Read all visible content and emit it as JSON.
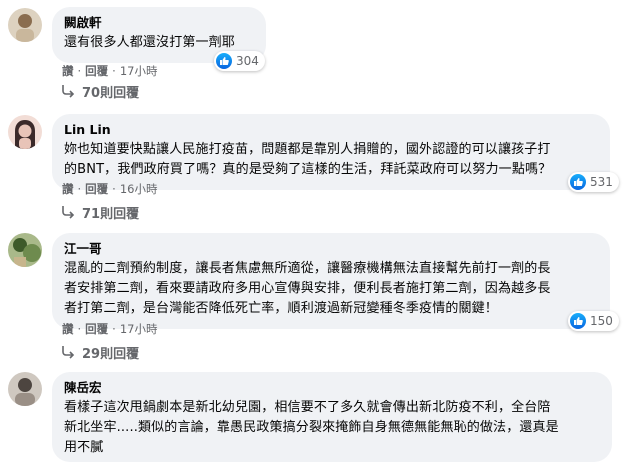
{
  "comments": [
    {
      "author": "闕啟軒",
      "lines": [
        "還有很多人都還沒打第一劑耶"
      ],
      "reaction_count": "304",
      "actions": {
        "like": "讚",
        "reply": "回覆",
        "time": "17小時"
      },
      "replies_label": "70則回覆",
      "avatar_colors": [
        "#c9b79c",
        "#8a6d4f"
      ]
    },
    {
      "author": "Lin Lin",
      "lines": [
        "妳也知道要快點讓人民施打疫苗，問題都是靠別人捐贈的，國外認證的可以讓孩子打",
        "的BNT，我們政府買了嗎？真的是受夠了這樣的生活，拜託菜政府可以努力一點嗎？"
      ],
      "reaction_count": "531",
      "actions": {
        "like": "讚",
        "reply": "回覆",
        "time": "16小時"
      },
      "replies_label": "71則回覆",
      "avatar_colors": [
        "#e8c4b8",
        "#3b2a2a"
      ]
    },
    {
      "author": "江一哥",
      "lines": [
        "混亂的二劑預約制度，讓長者焦慮無所適從，讓醫療機構無法直接幫先前打一劑的長",
        "者安排第二劑，看來要請政府多用心宣傳與安排，便利長者施打第二劑，因為越多長",
        "者打第二劑，是台灣能否降低死亡率，順利渡過新冠變種冬季疫情的關鍵！"
      ],
      "reaction_count": "150",
      "actions": {
        "like": "讚",
        "reply": "回覆",
        "time": "17小時"
      },
      "replies_label": "29則回覆",
      "avatar_colors": [
        "#6e8b4e",
        "#3d5a2a"
      ]
    },
    {
      "author": "陳岳宏",
      "lines": [
        "看樣子這次甩鍋劇本是新北幼兒園，相信要不了多久就會傳出新北防疫不利，全台陪",
        "新北坐牢.....類似的言論，靠愚民政策搞分裂來掩飾自身無德無能無恥的做法，還真是",
        "用不膩"
      ],
      "avatar_colors": [
        "#9a8f86",
        "#4d4540"
      ]
    }
  ],
  "colors": {
    "bubble": "#f0f2f5",
    "like_blue": "#1877f2",
    "secondary_text": "#65676b"
  }
}
